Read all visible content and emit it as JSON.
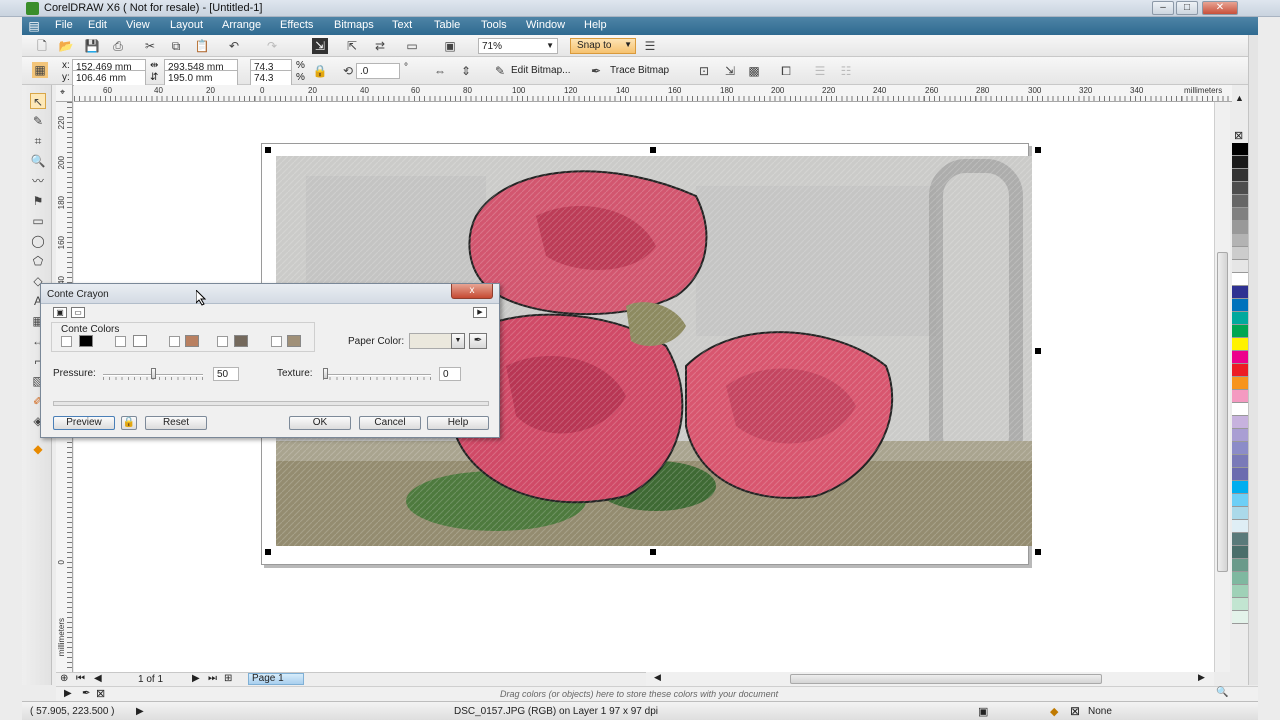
{
  "window": {
    "title": "CorelDRAW X6 ( Not for resale) - [Untitled-1]"
  },
  "menu": [
    "File",
    "Edit",
    "View",
    "Layout",
    "Arrange",
    "Effects",
    "Bitmaps",
    "Text",
    "Table",
    "Tools",
    "Window",
    "Help"
  ],
  "standard_toolbar": {
    "zoom": "71%",
    "snap_to": "Snap to"
  },
  "property_bar": {
    "x": "152.469 mm",
    "y": "106.46 mm",
    "width": "293.548 mm",
    "height": "195.0 mm",
    "scale_x": "74.3",
    "scale_y": "74.3",
    "pct": "%",
    "rotation": ".0",
    "deg": "°",
    "edit_bitmap": "Edit Bitmap...",
    "trace_bitmap": "Trace Bitmap"
  },
  "ruler": {
    "h_ticks": [
      "60",
      "40",
      "20",
      "0",
      "20",
      "40",
      "60",
      "80",
      "100",
      "120",
      "140",
      "160",
      "180",
      "200",
      "220",
      "240",
      "260",
      "280",
      "300",
      "320",
      "340"
    ],
    "unit": "millimeters",
    "v_ticks": [
      "220",
      "200",
      "180",
      "160",
      "140",
      "0"
    ],
    "v_unit": "millimeters"
  },
  "dialog": {
    "title": "Conte Crayon",
    "close": "x",
    "conte_colors_label": "Conte Colors",
    "swatches": [
      "#000000",
      "#ffffff",
      "#b98061",
      "#74695c",
      "#a09078"
    ],
    "paper_color_label": "Paper Color:",
    "paper_color": "#ebe8dd",
    "pressure_label": "Pressure:",
    "pressure_value": "50",
    "pressure_level": 0.5,
    "texture_label": "Texture:",
    "texture_value": "0",
    "texture_level": 0,
    "preview": "Preview",
    "reset": "Reset",
    "ok": "OK",
    "cancel": "Cancel",
    "help": "Help"
  },
  "doc_nav": {
    "page_count": "1 of 1",
    "page_tab": "Page 1"
  },
  "status": {
    "hint": "Drag colors (or objects) here to store these colors with your document",
    "coords": "( 57.905, 223.500 )",
    "object_info": "DSC_0157.JPG (RGB) on Layer 1 97 x 97 dpi",
    "fill": "None"
  },
  "palette": [
    "#000000",
    "#1a1a1a",
    "#333333",
    "#4d4d4d",
    "#666666",
    "#808080",
    "#999999",
    "#b3b3b3",
    "#cccccc",
    "#e6e6e6",
    "#ffffff",
    "#2e3192",
    "#0072bc",
    "#00a99d",
    "#00a651",
    "#fff200",
    "#ec008c",
    "#ed1c24",
    "#f7941d",
    "#f49ac1",
    "#ffffff",
    "#c7b2de",
    "#a99ed3",
    "#8c8cc8",
    "#7a7ab8",
    "#6b6baf",
    "#00aeef",
    "#6dcff6",
    "#abd9e9",
    "#dfeef5",
    "#5a7a7a",
    "#4a6e6a",
    "#6a9a8a",
    "#7fb8a0",
    "#9fd1b7",
    "#c2e5d1",
    "#e3f3ea"
  ]
}
